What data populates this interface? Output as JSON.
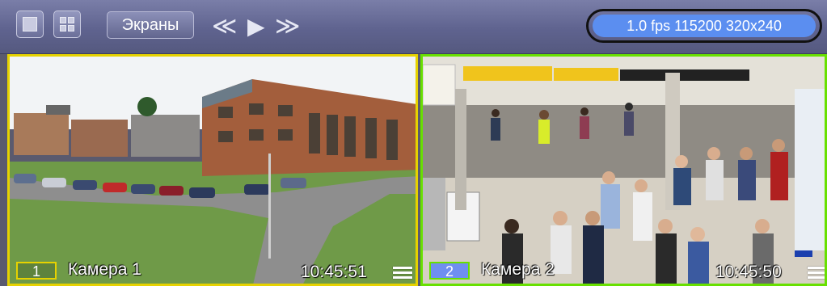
{
  "toolbar": {
    "layout_single_icon": "single-view-icon",
    "layout_grid_icon": "grid-view-icon",
    "screens_label": "Экраны",
    "prev_label": "≪",
    "play_label": "▶",
    "next_label": "≫",
    "stream_info": "1.0 fps 115200 320x240",
    "accent_color": "#5b8ef0"
  },
  "cameras": [
    {
      "number": "1",
      "name": "Камера 1",
      "time": "10:45:51",
      "border_color": "#e6d200",
      "menu_icon": "hamburger-menu-icon"
    },
    {
      "number": "2",
      "name": "Камера 2",
      "time": "10:45:50",
      "border_color": "#68e000",
      "menu_icon": "hamburger-menu-icon"
    }
  ]
}
